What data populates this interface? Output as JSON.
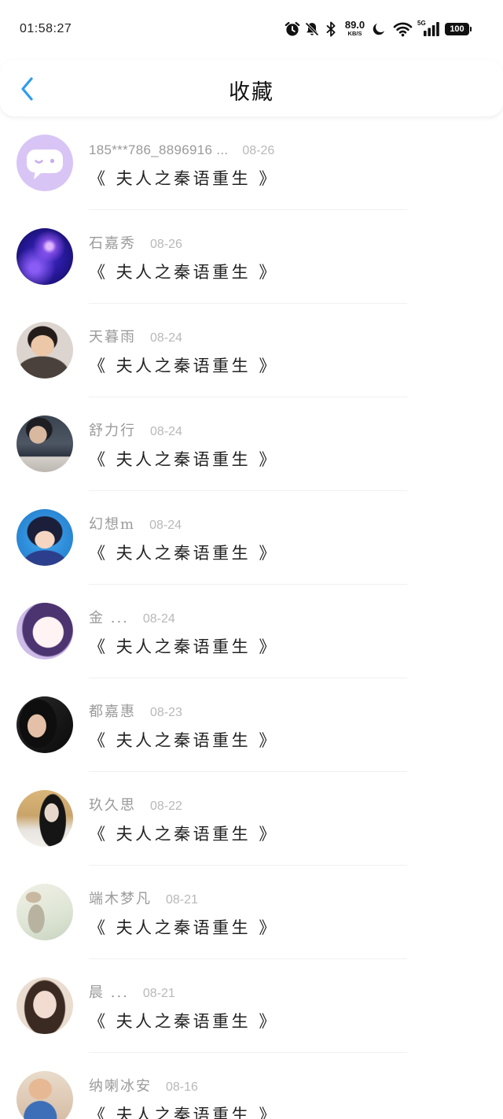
{
  "status_bar": {
    "time": "01:58:27",
    "net_speed": "89.0",
    "net_speed_unit": "KB/S",
    "network": "5G",
    "battery": "100",
    "icons": [
      "alarm-icon",
      "bell-off-icon",
      "bluetooth-icon",
      "moon-icon",
      "wifi-icon",
      "signal-icon",
      "battery-icon"
    ]
  },
  "header": {
    "title": "收藏",
    "back_icon": "chevron-left-icon"
  },
  "colors": {
    "accent": "#2d9cf0",
    "title_text": "#222222",
    "meta_text": "#9a9a9a",
    "date_text": "#b8b8b8",
    "divider": "#f0f0f0",
    "default_avatar": "#d8c5f5"
  },
  "items": [
    {
      "name": "185***786_8896916 ...",
      "date": "08-26",
      "title": "《 夫人之秦语重生 》"
    },
    {
      "name": "石嘉秀",
      "date": "08-26",
      "title": "《 夫人之秦语重生 》"
    },
    {
      "name": "天暮雨",
      "date": "08-24",
      "title": "《 夫人之秦语重生 》"
    },
    {
      "name": "舒力行",
      "date": "08-24",
      "title": "《 夫人之秦语重生 》"
    },
    {
      "name": "幻想m",
      "date": "08-24",
      "title": "《 夫人之秦语重生 》"
    },
    {
      "name": "金 ...",
      "date": "08-24",
      "title": "《 夫人之秦语重生 》"
    },
    {
      "name": "都嘉惠",
      "date": "08-23",
      "title": "《 夫人之秦语重生 》"
    },
    {
      "name": "玖久思",
      "date": "08-22",
      "title": "《 夫人之秦语重生 》"
    },
    {
      "name": "端木梦凡",
      "date": "08-21",
      "title": "《 夫人之秦语重生 》"
    },
    {
      "name": "晨 ...",
      "date": "08-21",
      "title": "《 夫人之秦语重生 》"
    },
    {
      "name": "纳喇冰安",
      "date": "08-16",
      "title": "《 夫人之秦语重生 》"
    }
  ]
}
